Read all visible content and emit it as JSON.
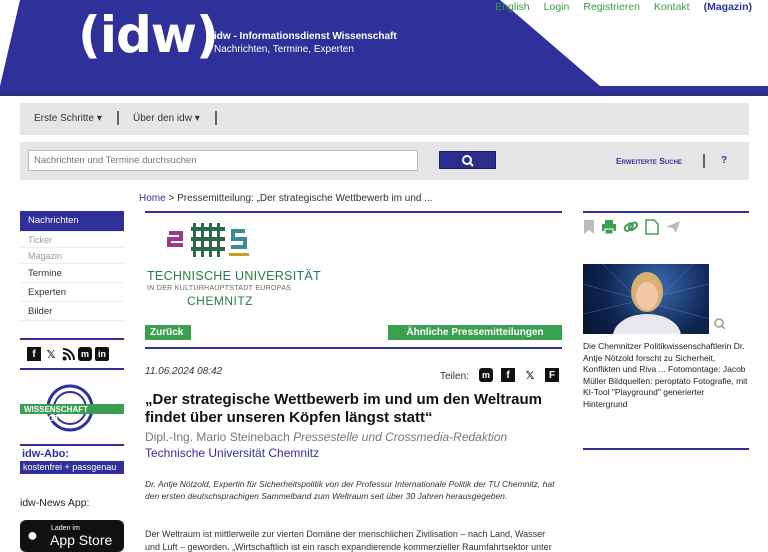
{
  "header": {
    "logo": "(idw)",
    "tagline_bold": "idw - Informationsdienst Wissenschaft",
    "tagline": "Nachrichten, Termine, Experten",
    "links": [
      "English",
      "Login",
      "Registrieren",
      "Kontakt"
    ],
    "magazin": "(Magazin)",
    "colors": {
      "brand": "#30309a",
      "accent": "#3a9a4a"
    }
  },
  "nav": {
    "items": [
      "Erste Schritte",
      "Über den idw"
    ]
  },
  "search": {
    "placeholder": "Nachrichten und Termine durchsuchen",
    "advanced": "Erweiterte Suche",
    "help": "?"
  },
  "breadcrumb": {
    "home": "Home",
    "rest": " > Pressemitteilung: „Der strategische Wettbewerb im und ..."
  },
  "sidebar": {
    "items": [
      {
        "label": "Nachrichten",
        "state": "active"
      },
      {
        "label": "Ticker",
        "state": "sub"
      },
      {
        "label": "Magazin",
        "state": "sub"
      },
      {
        "label": "Termine",
        "state": "normal"
      },
      {
        "label": "Experten",
        "state": "normal"
      },
      {
        "label": "Bilder",
        "state": "normal"
      }
    ],
    "wb_label": "WISSENSCHAFT BEWEGT",
    "abo_title": "idw-Abo:",
    "abo_sub": "kostenfrei + passgenau",
    "newsapp": "idw-News App:",
    "appstore_small": "Laden im",
    "appstore_big": "App Store"
  },
  "article": {
    "institution_logo_line1": "TECHNISCHE UNIVERSITÄT",
    "institution_logo_line2": "IN DER KULTURHAUPTSTADT EUROPAS",
    "institution_logo_line3": "CHEMNITZ",
    "back": "Zurück",
    "similar": "Ähnliche Pressemitteilungen",
    "date": "11.06.2024 08:42",
    "share_label": "Teilen:",
    "title": "„Der strategische Wettbewerb im und um den Weltraum findet über unseren Köpfen längst statt“",
    "author_name": "Dipl.-Ing. Mario Steinebach",
    "author_role": "Pressestelle und Crossmedia-Redaktion",
    "institution": "Technische Universität Chemnitz",
    "lead": "Dr. Antje Nötzold, Expertin für Sicherheitspolitik von der Professur Internationale Politik der TU Chemnitz, hat den ersten deutschsprachigen Sammelband zum Weltraum seit über 30 Jahren herausgegeben.",
    "body": "Der Weltraum ist mittlerweile zur vierten Domäne der menschlichen Zivilisation – nach Land, Wasser und Luft – geworden. „Wirtschaftlich ist ein rasch expandierende kommerzieller Raumfahrtsektor unter"
  },
  "right": {
    "caption": "Die Chemnitzer Politikwissenschaftlerin Dr. Antje Nötzold forscht zu Sicherheit, Konflikten und Riva ... Fotomontage: Jacob Müller Bildquellen: peroptato Fotografie, mit KI-Tool \"Playground\" generierter Hintergrund"
  }
}
